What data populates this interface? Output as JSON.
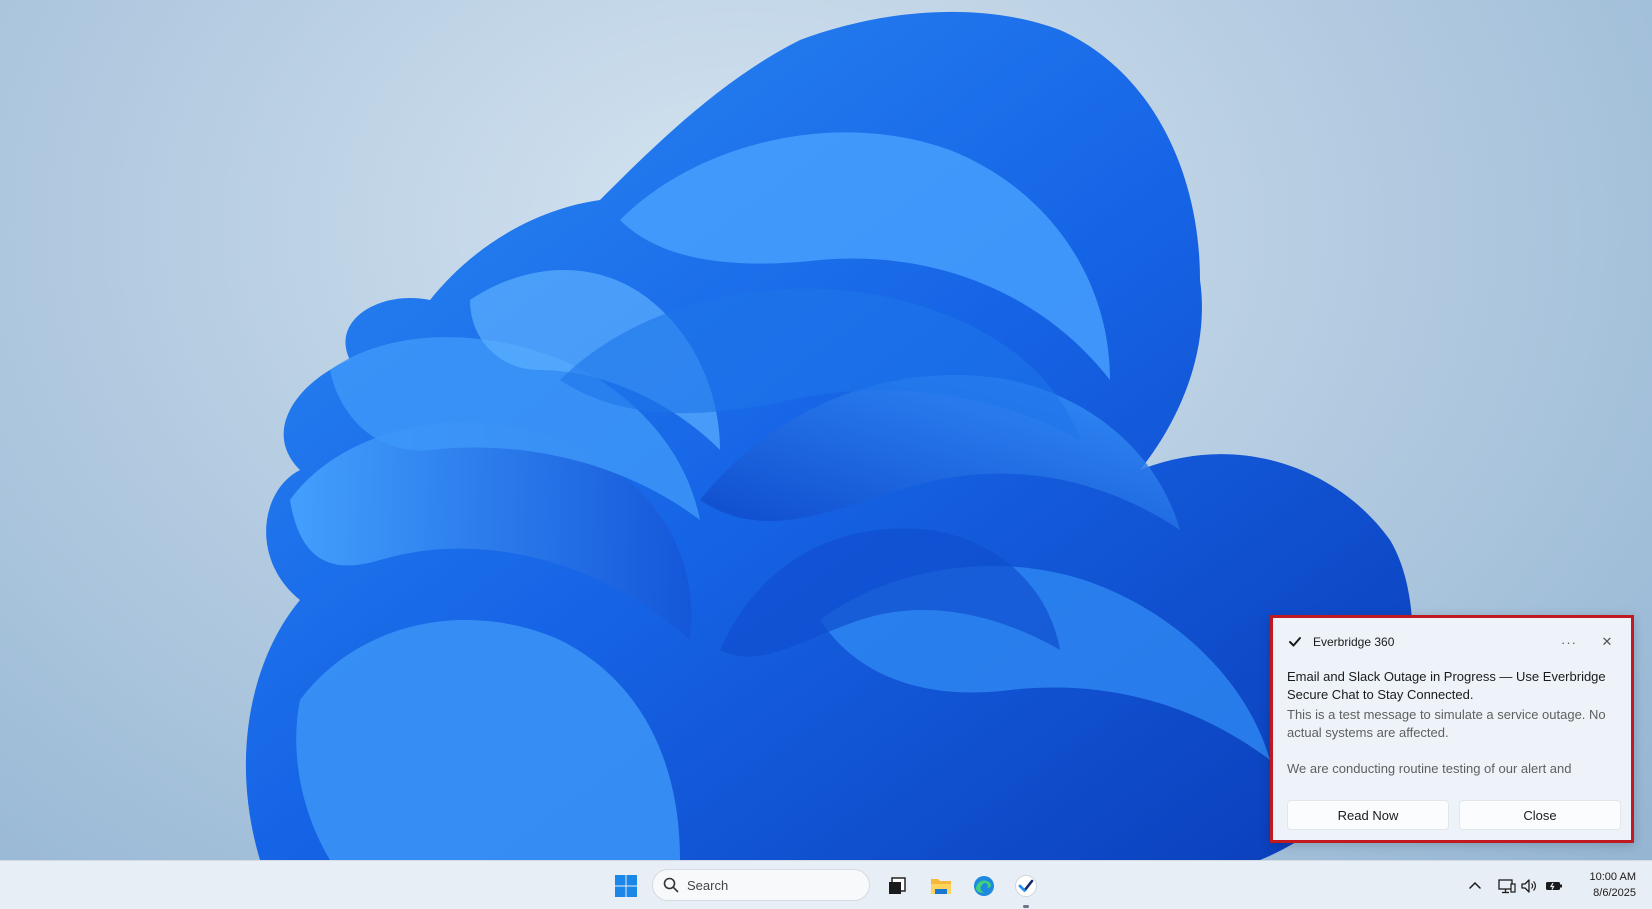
{
  "notification": {
    "app_name": "Everbridge 360",
    "more_label": "···",
    "close_glyph": "✕",
    "title": "Email and Slack Outage in Progress — Use Everbridge Secure Chat to Stay Connected.",
    "body": "This is a test message to simulate a service outage. No actual systems are affected.",
    "body_more": "We are conducting routine testing of our alert and",
    "actions": [
      "Read Now",
      "Close"
    ]
  },
  "taskbar": {
    "search_label": "Search",
    "pinned_icons": [
      "start-icon",
      "task-view-icon",
      "file-explorer-icon",
      "edge-icon",
      "everbridge-icon"
    ],
    "tray_icons": [
      "chevron-up-icon",
      "network-icon",
      "volume-icon",
      "battery-icon"
    ],
    "time": "10:00 AM",
    "date": "8/6/2025"
  },
  "colors": {
    "highlight_border": "#c0191f",
    "wallpaper_blue": "#1565e0",
    "accent": "#0078d4"
  }
}
